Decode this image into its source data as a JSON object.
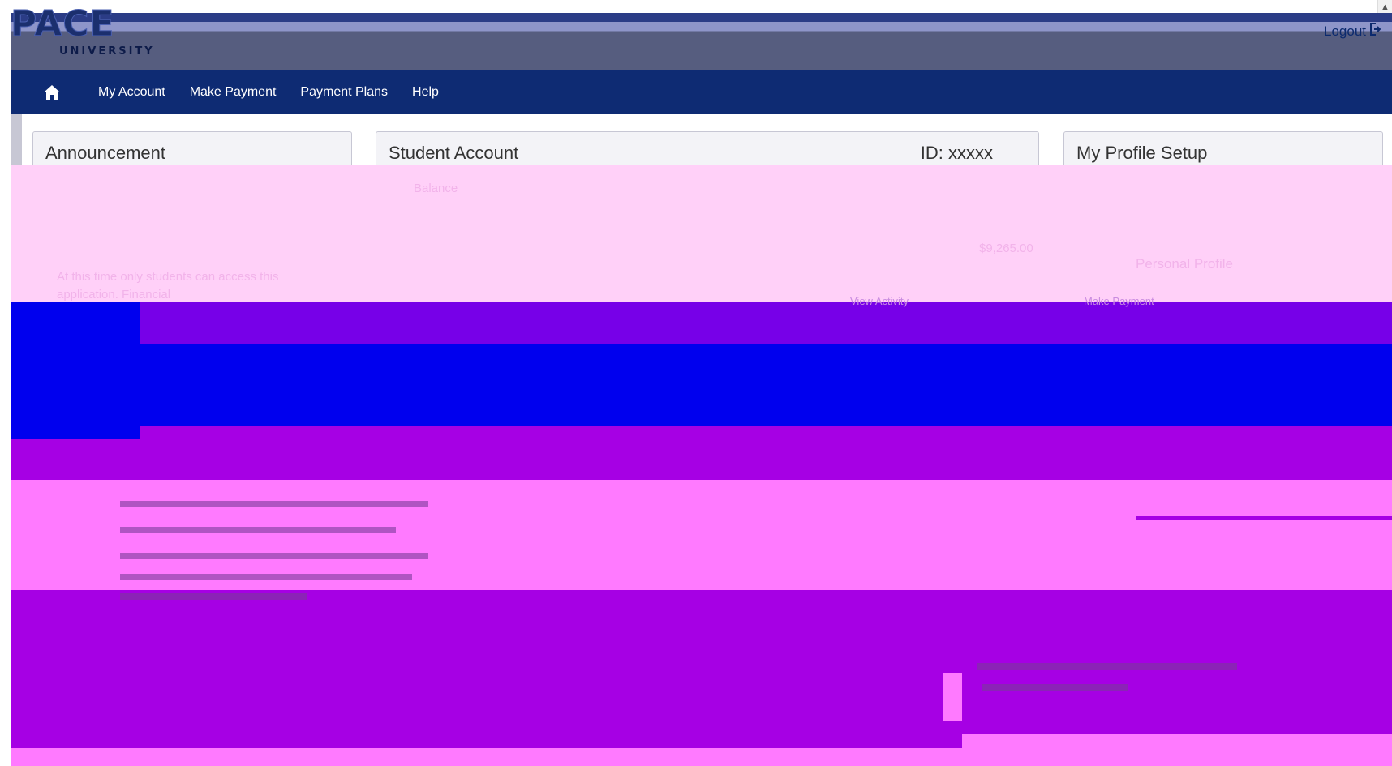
{
  "header": {
    "logo_text": "PACE",
    "logo_sub": "UNIVERSITY",
    "logout_label": "Logout"
  },
  "nav": {
    "items": [
      {
        "label": "My Account"
      },
      {
        "label": "Make Payment"
      },
      {
        "label": "Payment Plans"
      },
      {
        "label": "Help"
      }
    ]
  },
  "panels": {
    "announcement": {
      "title": "Announcement"
    },
    "student_account": {
      "title": "Student Account",
      "id_label": "ID: xxxxx"
    },
    "profile": {
      "title": "My Profile Setup"
    }
  },
  "faint": {
    "balance_label": "Balance",
    "amount_label": "$9,265.00",
    "announcement_text_1": "At this time only students can access this",
    "announcement_text_2": "application. Financial",
    "personal_profile": "Personal Profile",
    "view_activity": "View Activity",
    "make_payment": "Make Payment"
  },
  "colors": {
    "navbar": "#0e2b73",
    "logo_band": "#565d7f",
    "brand": "#1b2f6e"
  }
}
